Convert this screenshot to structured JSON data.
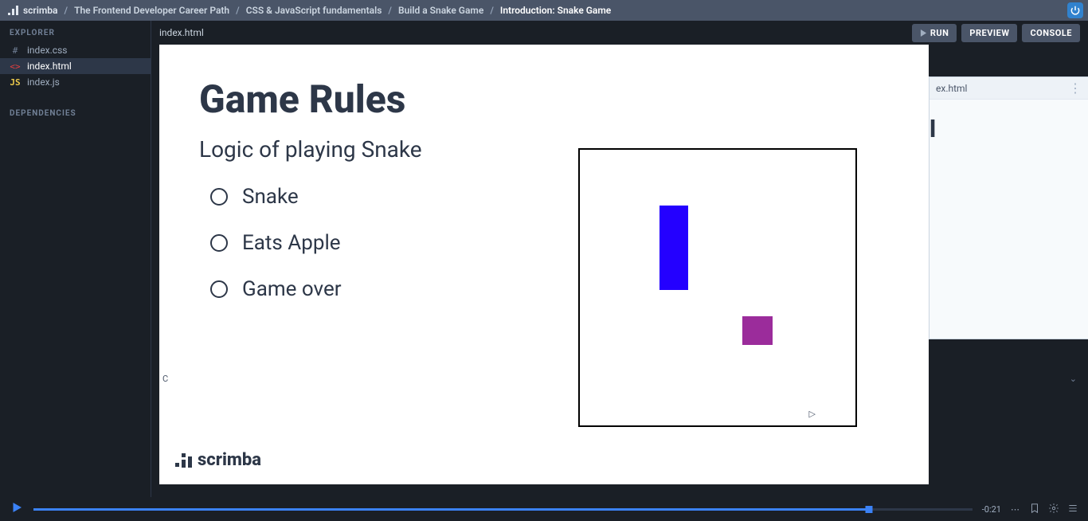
{
  "topbar": {
    "brand": "scrimba",
    "crumbs": [
      "The Frontend Developer Career Path",
      "CSS & JavaScript fundamentals",
      "Build a Snake Game",
      "Introduction: Snake Game"
    ]
  },
  "sidebar": {
    "explorer_title": "EXPLORER",
    "files": [
      {
        "name": "index.css",
        "icon": "#",
        "cls": "css",
        "active": false
      },
      {
        "name": "index.html",
        "icon": "<>",
        "cls": "html",
        "active": true
      },
      {
        "name": "index.js",
        "icon": "JS",
        "cls": "js",
        "active": false
      }
    ],
    "deps_title": "DEPENDENCIES"
  },
  "tabs": {
    "open_file": "index.html",
    "run": "RUN",
    "preview": "PREVIEW",
    "console": "CONSOLE"
  },
  "slide": {
    "title": "Game Rules",
    "subtitle": "Logic of playing Snake",
    "items": [
      "Snake",
      "Eats Apple",
      "Game over"
    ],
    "brand": "scrimba"
  },
  "preview_peek": {
    "tab": "ex.html",
    "big": "l"
  },
  "lower_strip": {
    "left": "C"
  },
  "player": {
    "time": "-0:21",
    "progress_pct": 89
  }
}
